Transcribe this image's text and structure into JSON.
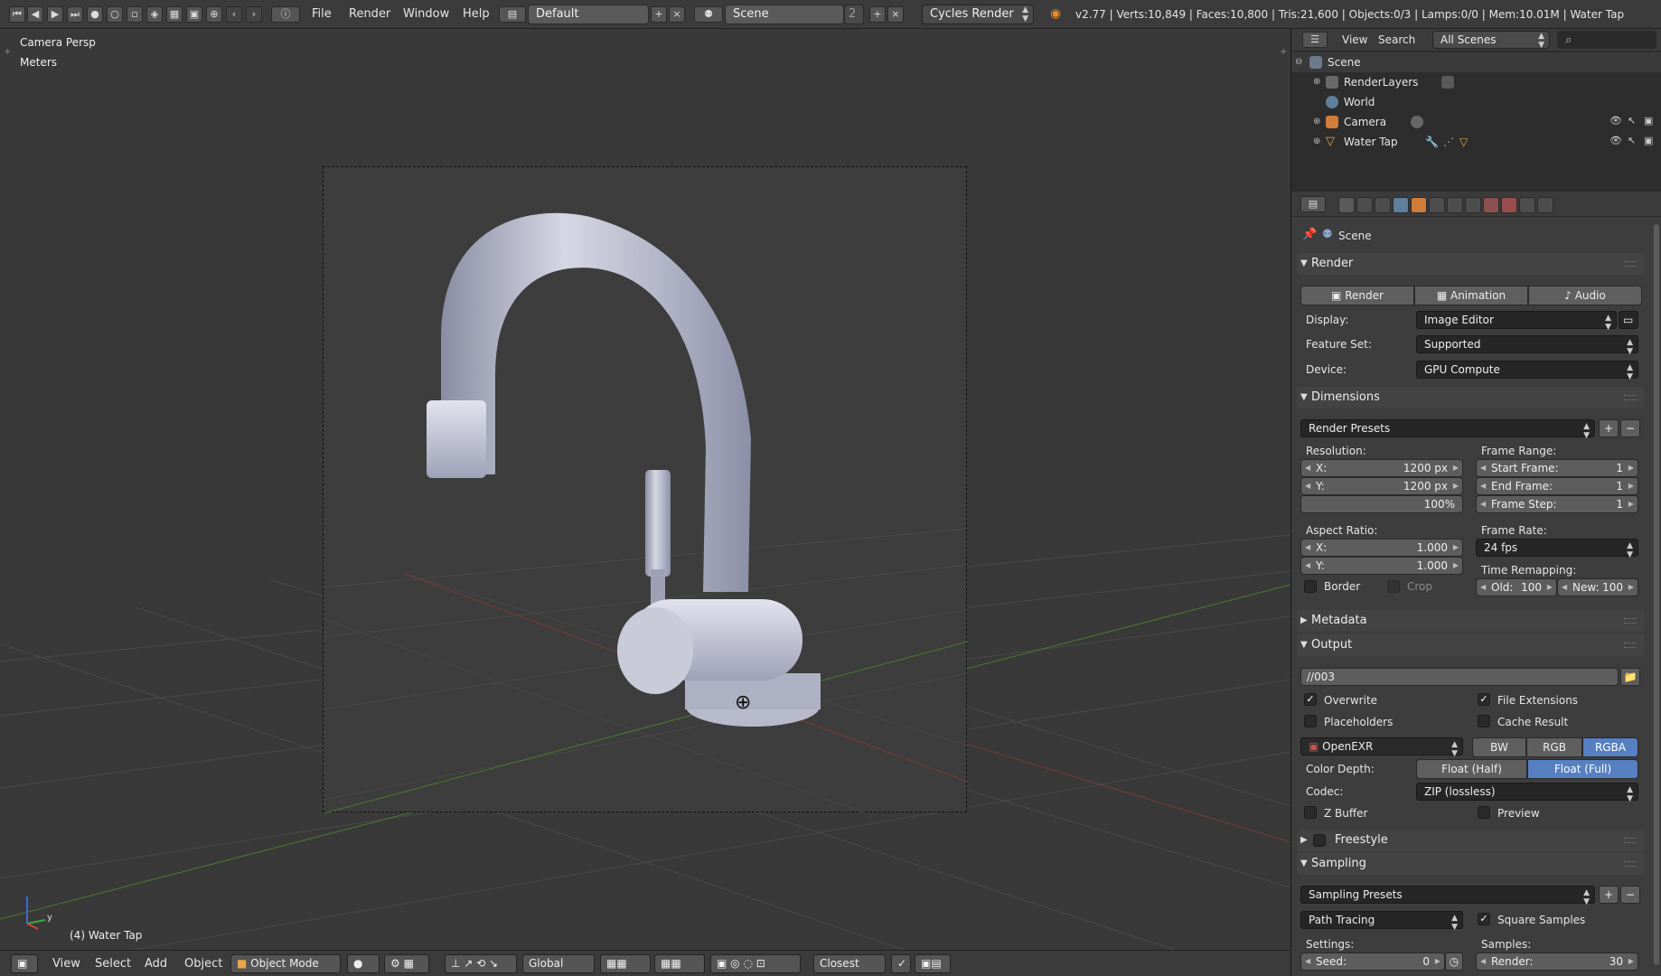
{
  "topbar": {
    "menus": [
      "File",
      "Render",
      "Window",
      "Help"
    ],
    "layout_name": "Default",
    "scene_name": "Scene",
    "scene_users": "2",
    "render_engine": "Cycles Render",
    "stats": "v2.77 | Verts:10,849 | Faces:10,800 | Tris:21,600 | Objects:0/3 | Lamps:0/0 | Mem:10.01M | Water Tap"
  },
  "viewport": {
    "view_name": "Camera Persp",
    "units": "Meters",
    "active_object": "(4) Water Tap"
  },
  "bottombar": {
    "menus": [
      "View",
      "Select",
      "Add",
      "Object"
    ],
    "mode": "Object Mode",
    "orientation": "Global",
    "snap": "Closest"
  },
  "outliner": {
    "header": {
      "view": "View",
      "search": "Search",
      "filter": "All Scenes"
    },
    "items": [
      {
        "label": "Scene",
        "icon": "scene-icon"
      },
      {
        "label": "RenderLayers",
        "icon": "renderlayers-icon"
      },
      {
        "label": "World",
        "icon": "world-icon"
      },
      {
        "label": "Camera",
        "icon": "camera-icon"
      },
      {
        "label": "Water Tap",
        "icon": "mesh-icon"
      }
    ]
  },
  "properties": {
    "context": "Scene",
    "render": {
      "title": "Render",
      "buttons": [
        "Render",
        "Animation",
        "Audio"
      ],
      "display_label": "Display:",
      "display_value": "Image Editor",
      "feature_label": "Feature Set:",
      "feature_value": "Supported",
      "device_label": "Device:",
      "device_value": "GPU Compute"
    },
    "dimensions": {
      "title": "Dimensions",
      "presets": "Render Presets",
      "resolution_label": "Resolution:",
      "res_x_label": "X:",
      "res_x": "1200 px",
      "res_y_label": "Y:",
      "res_y": "1200 px",
      "res_pct": "100%",
      "aspect_label": "Aspect Ratio:",
      "aspect_x_label": "X:",
      "aspect_x": "1.000",
      "aspect_y_label": "Y:",
      "aspect_y": "1.000",
      "border": "Border",
      "crop": "Crop",
      "frame_range_label": "Frame Range:",
      "start_label": "Start Frame:",
      "start": "1",
      "end_label": "End Frame:",
      "end": "1",
      "step_label": "Frame Step:",
      "step": "1",
      "frame_rate_label": "Frame Rate:",
      "frame_rate": "24 fps",
      "time_remap_label": "Time Remapping:",
      "old_label": "Old:",
      "old": "100",
      "new_label": "New:",
      "new": "100"
    },
    "metadata": {
      "title": "Metadata"
    },
    "output": {
      "title": "Output",
      "path": "//003",
      "overwrite": "Overwrite",
      "file_ext": "File Extensions",
      "placeholders": "Placeholders",
      "cache_result": "Cache Result",
      "format": "OpenEXR",
      "color_modes": [
        "BW",
        "RGB",
        "RGBA"
      ],
      "color_depth_label": "Color Depth:",
      "depths": [
        "Float (Half)",
        "Float (Full)"
      ],
      "codec_label": "Codec:",
      "codec": "ZIP (lossless)",
      "zbuffer": "Z Buffer",
      "preview": "Preview"
    },
    "freestyle": {
      "title": "Freestyle"
    },
    "sampling": {
      "title": "Sampling",
      "presets": "Sampling Presets",
      "integrator": "Path Tracing",
      "square_samples": "Square Samples",
      "settings_label": "Settings:",
      "samples_label": "Samples:",
      "seed_label": "Seed:",
      "seed": "0",
      "render_label": "Render:",
      "render": "30"
    }
  }
}
